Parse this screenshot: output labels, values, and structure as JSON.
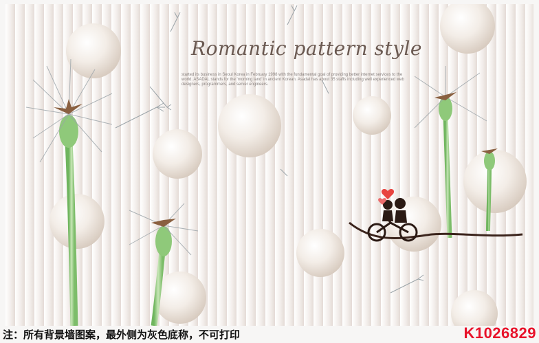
{
  "poster": {
    "title": "Romantic pattern style",
    "body_text": "started its business in Seoul Korea in February 1998 with the fundamental goal of providing better internet services to the world. ASADAL stands for the 'morning land' in ancient Korean. Asadal has about 35 staffs including well experienced web designers, programmers, and server engineers.",
    "footer_note": "注：所有背景墙图案，最外侧为灰色底称，不可打印",
    "product_code": "K1026829"
  },
  "colors": {
    "accent_code": "#e8122a",
    "stem": "#8fc97a",
    "pearl": "#ece4dc",
    "heart": "#e8443f"
  },
  "icons": [
    "dandelion-icon",
    "pearl-sphere-icon",
    "couple-bicycle-icon",
    "heart-icon",
    "seed-icon"
  ]
}
